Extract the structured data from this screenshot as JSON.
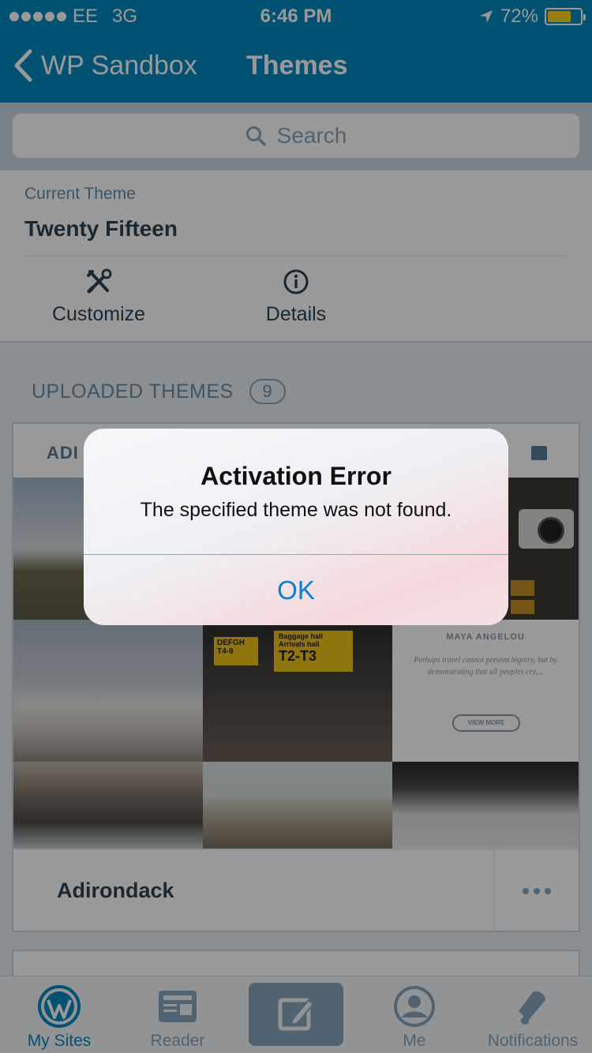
{
  "status_bar": {
    "carrier": "EE",
    "network": "3G",
    "time": "6:46 PM",
    "battery": "72%",
    "battery_level": 0.72,
    "battery_color": "#ffd21f"
  },
  "nav": {
    "back_label": "WP Sandbox",
    "title": "Themes"
  },
  "search": {
    "placeholder": "Search"
  },
  "current_theme": {
    "label": "Current Theme",
    "name": "Twenty Fifteen",
    "actions": [
      {
        "label": "Customize",
        "icon": "tools-icon"
      },
      {
        "label": "Details",
        "icon": "info-icon"
      }
    ]
  },
  "uploaded": {
    "label": "UPLOADED THEMES",
    "count": "9"
  },
  "theme_card": {
    "preview_logo": "ADI",
    "name": "Adirondack",
    "preview_text": {
      "heading": "MAYA ANGELOU",
      "quote": "Perhaps travel cannot prevent bigotry, but by demonstrating that all peoples cry,...",
      "button": "VIEW MORE",
      "sign_top": "DEFGH",
      "sign_gate": "T4-9",
      "sign_baggage": "Baggage hall",
      "sign_arrivals": "Arrivals hall",
      "sign_terminal": "T2-T3"
    }
  },
  "tabbar": {
    "tabs": [
      {
        "label": "My Sites",
        "icon": "wordpress-icon",
        "active": true
      },
      {
        "label": "Reader",
        "icon": "reader-icon",
        "active": false
      },
      {
        "label": "",
        "icon": "write-icon",
        "active": false
      },
      {
        "label": "Me",
        "icon": "me-icon",
        "active": false
      },
      {
        "label": "Notifications",
        "icon": "bell-icon",
        "active": false
      }
    ]
  },
  "alert": {
    "title": "Activation Error",
    "message": "The specified theme was not found.",
    "ok_label": "OK"
  },
  "colors": {
    "brand": "#0087be",
    "text": "#2e4453",
    "muted": "#87a6bc",
    "alert_button": "#0a7ed3"
  }
}
